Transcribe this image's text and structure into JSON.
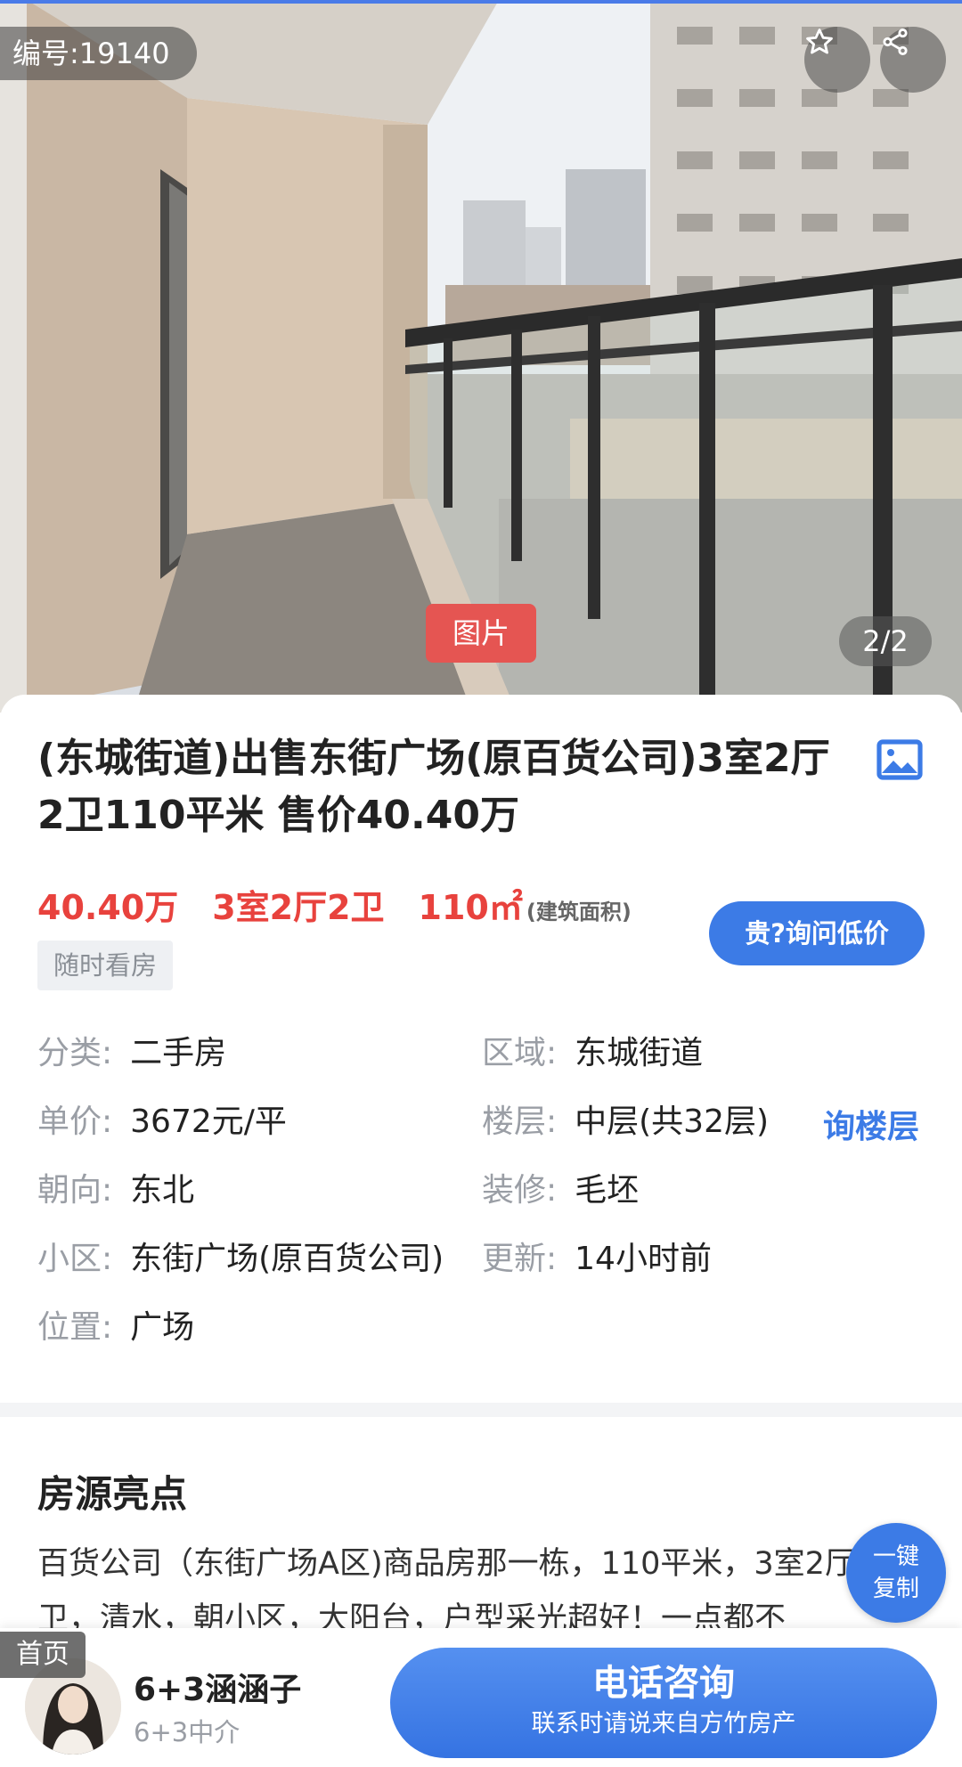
{
  "listing": {
    "id_label": "编号:19140",
    "photo_tag": "图片",
    "photo_counter": "2/2",
    "title": "(东城街道)出售东街广场(原百货公司)3室2厅2卫110平米 售价40.40万",
    "price": "40.40万",
    "layout": "3室2厅2卫",
    "area": "110㎡",
    "area_note": "(建筑面积)",
    "ask_price_button": "贵?询问低价",
    "viewing_tag": "随时看房",
    "ask_floor_button": "询楼层"
  },
  "info": {
    "category": {
      "label": "分类:",
      "value": "二手房"
    },
    "district": {
      "label": "区域:",
      "value": "东城街道"
    },
    "unit_price": {
      "label": "单价:",
      "value": "3672元/平"
    },
    "floor": {
      "label": "楼层:",
      "value": "中层(共32层)"
    },
    "orientation": {
      "label": "朝向:",
      "value": "东北"
    },
    "decoration": {
      "label": "装修:",
      "value": "毛坯"
    },
    "community": {
      "label": "小区:",
      "value": "东街广场(原百货公司)"
    },
    "updated": {
      "label": "更新:",
      "value": "14小时前"
    },
    "location": {
      "label": "位置:",
      "value": "广场"
    }
  },
  "highlights": {
    "title": "房源亮点",
    "text": "百货公司（东街广场A区)商品房那一栋，110平米，3室2厅2卫，清水，朝小区，大阳台，户型采光超好！一点都不",
    "copy_button_line1": "一键",
    "copy_button_line2": "复制"
  },
  "bottom_bar": {
    "home_tag": "首页",
    "agent_name": "6+3涵涵子",
    "agent_org": "6+3中介",
    "call_title": "电话咨询",
    "call_subtitle": "联系时请说来自方竹房产"
  },
  "colors": {
    "accent_blue": "#3c7be6",
    "price_red": "#e8423d"
  },
  "icons": [
    "star-icon",
    "share-icon",
    "image-icon"
  ]
}
